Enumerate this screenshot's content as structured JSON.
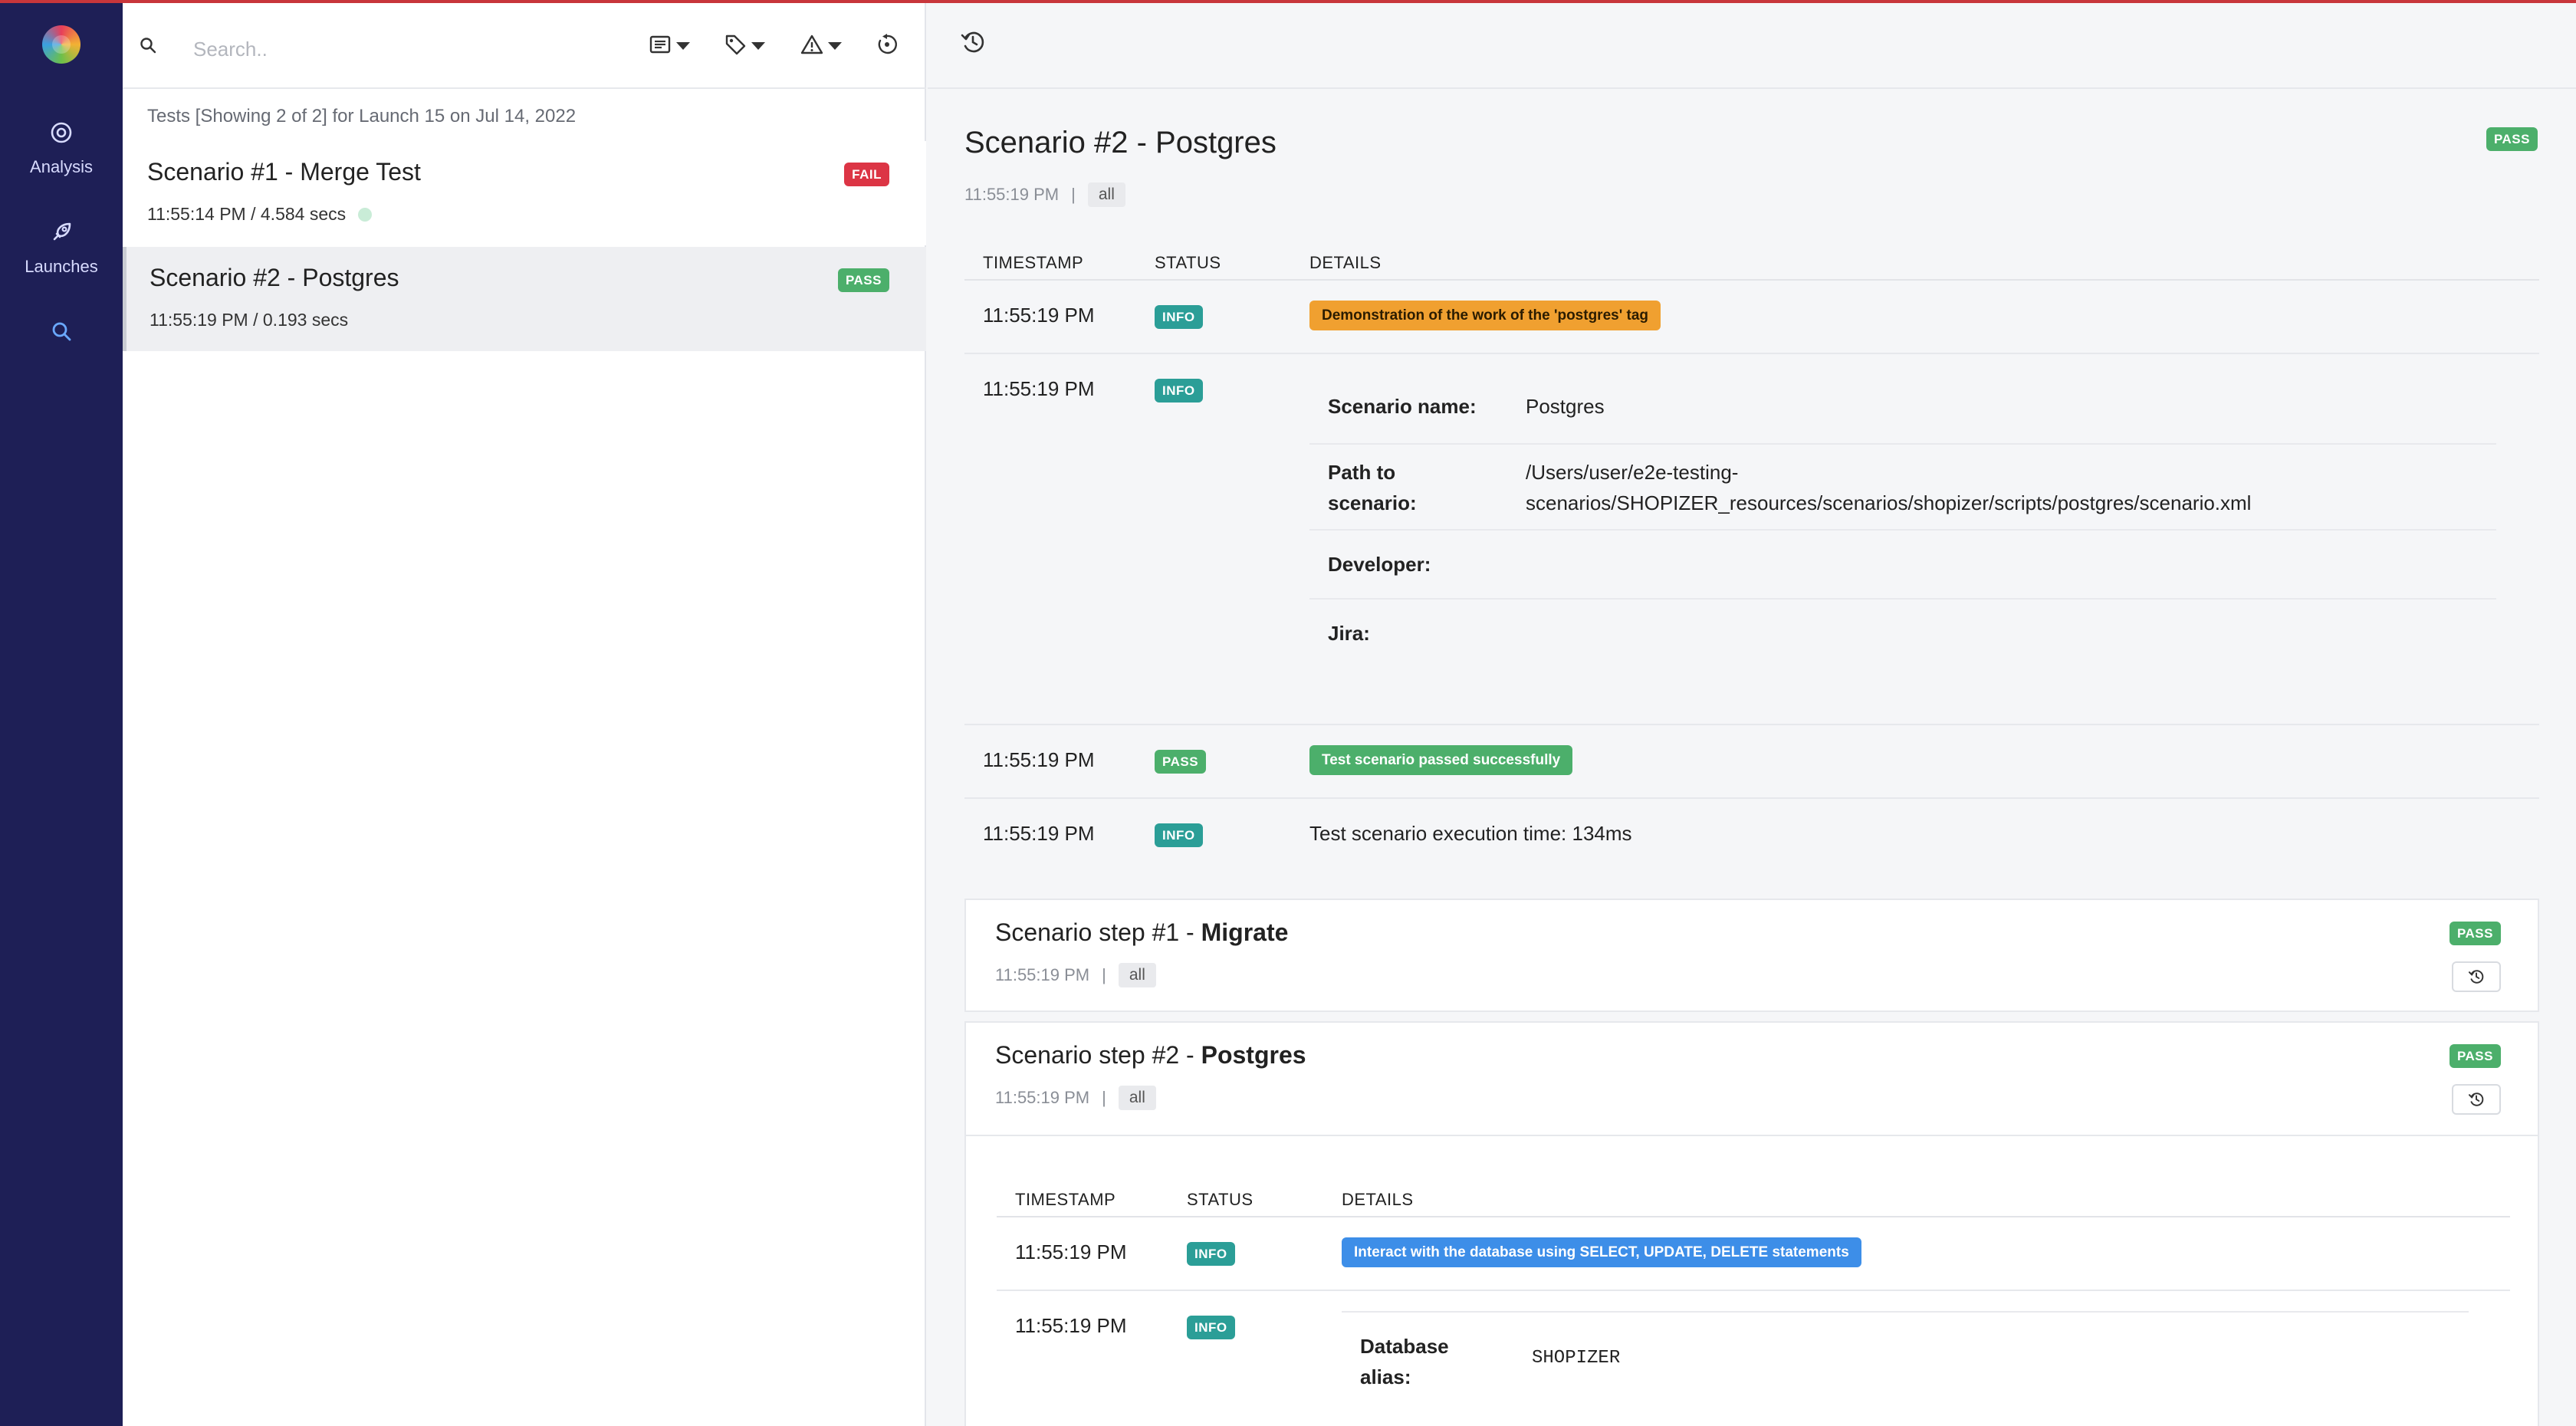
{
  "sidebar": {
    "items": [
      {
        "label": "Analysis",
        "icon": "target-icon"
      },
      {
        "label": "Launches",
        "icon": "rocket-icon"
      },
      {
        "label": "",
        "icon": "search-icon"
      }
    ]
  },
  "toolbar": {
    "search_placeholder": "Search.."
  },
  "tests": {
    "header": "Tests [Showing 2 of 2] for Launch 15 on Jul 14, 2022",
    "items": [
      {
        "title": "Scenario #1 - Merge Test",
        "meta": "11:55:14 PM / 4.584 secs",
        "status": "FAIL"
      },
      {
        "title": "Scenario #2 - Postgres",
        "meta": "11:55:19 PM / 0.193 secs",
        "status": "PASS"
      }
    ]
  },
  "scenario": {
    "title": "Scenario #2 - Postgres",
    "status": "PASS",
    "time": "11:55:19 PM",
    "separator": "|",
    "tag": "all"
  },
  "log": {
    "headers": {
      "timestamp": "TIMESTAMP",
      "status": "STATUS",
      "details": "DETAILS"
    },
    "rows": [
      {
        "ts": "11:55:19 PM",
        "status": "INFO",
        "detail": "Demonstration of the work of the 'postgres' tag"
      },
      {
        "ts": "11:55:19 PM",
        "status": "INFO"
      },
      {
        "ts": "11:55:19 PM",
        "status": "PASS",
        "detail": "Test scenario passed successfully"
      },
      {
        "ts": "11:55:19 PM",
        "status": "INFO",
        "detail": "Test scenario execution time: 134ms"
      }
    ],
    "info": {
      "name_key": "Scenario name:",
      "name_val": "Postgres",
      "path_key_1": "Path to",
      "path_key_2": "scenario:",
      "path_val_1": "/Users/user/e2e-testing-",
      "path_val_2": "scenarios/SHOPIZER_resources/scenarios/shopizer/scripts/postgres/scenario.xml",
      "dev_key": "Developer:",
      "jira_key": "Jira:"
    }
  },
  "steps": [
    {
      "prefix": "Scenario step #1 - ",
      "name": "Migrate",
      "time": "11:55:19 PM",
      "separator": "|",
      "tag": "all",
      "status": "PASS"
    },
    {
      "prefix": "Scenario step #2 - ",
      "name": "Postgres",
      "time": "11:55:19 PM",
      "separator": "|",
      "tag": "all",
      "status": "PASS"
    }
  ],
  "step_log": {
    "headers": {
      "timestamp": "TIMESTAMP",
      "status": "STATUS",
      "details": "DETAILS"
    },
    "rows": [
      {
        "ts": "11:55:19 PM",
        "status": "INFO",
        "detail": "Interact with the database using SELECT, UPDATE, DELETE statements"
      },
      {
        "ts": "11:55:19 PM",
        "status": "INFO"
      }
    ],
    "db_key_1": "Database",
    "db_key_2": "alias:",
    "db_val": "SHOPIZER"
  },
  "colors": {
    "sidebar": "#1e1f56",
    "fail": "#dc3545",
    "pass": "#4caf6b",
    "info": "#2b9e97",
    "tag_orange": "#f0a030",
    "tag_blue": "#3d8ee8",
    "accent_top": "#c8363b"
  }
}
